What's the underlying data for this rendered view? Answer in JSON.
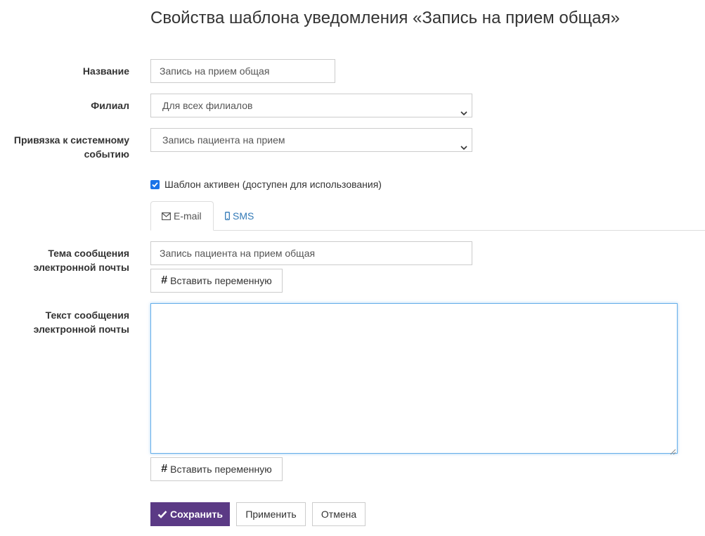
{
  "page": {
    "title": "Свойства шаблона уведомления «Запись на прием общая»"
  },
  "form": {
    "name": {
      "label": "Название",
      "value": "Запись на прием общая"
    },
    "branch": {
      "label": "Филиал",
      "value": "Для всех филиалов"
    },
    "event": {
      "label_line1": "Привязка к системному",
      "label_line2": "событию",
      "value": "Запись пациента на прием"
    },
    "active_checkbox": {
      "label": "Шаблон активен (доступен для использования)",
      "checked": true
    }
  },
  "tabs": [
    {
      "label": "E-mail",
      "icon": "envelope-icon",
      "active": true
    },
    {
      "label": "SMS",
      "icon": "mobile-phone-icon",
      "active": false
    }
  ],
  "email": {
    "subject_label_line1": "Тема сообщения",
    "subject_label_line2": "электронной почты",
    "subject_value": "Запись пациента на прием общая",
    "insert_variable_label": "Вставить переменную",
    "body_label_line1": "Текст сообщения",
    "body_label_line2": "электронной почты",
    "body_value": "",
    "insert_variable_label_2": "Вставить переменную"
  },
  "actions": {
    "save_label": "Сохранить",
    "apply_label": "Применить",
    "cancel_label": "Отмена"
  },
  "colors": {
    "primary": "#5b3a85",
    "link": "#337ab7",
    "focus_border": "#66afe9",
    "checkbox": "#1a73e8"
  }
}
